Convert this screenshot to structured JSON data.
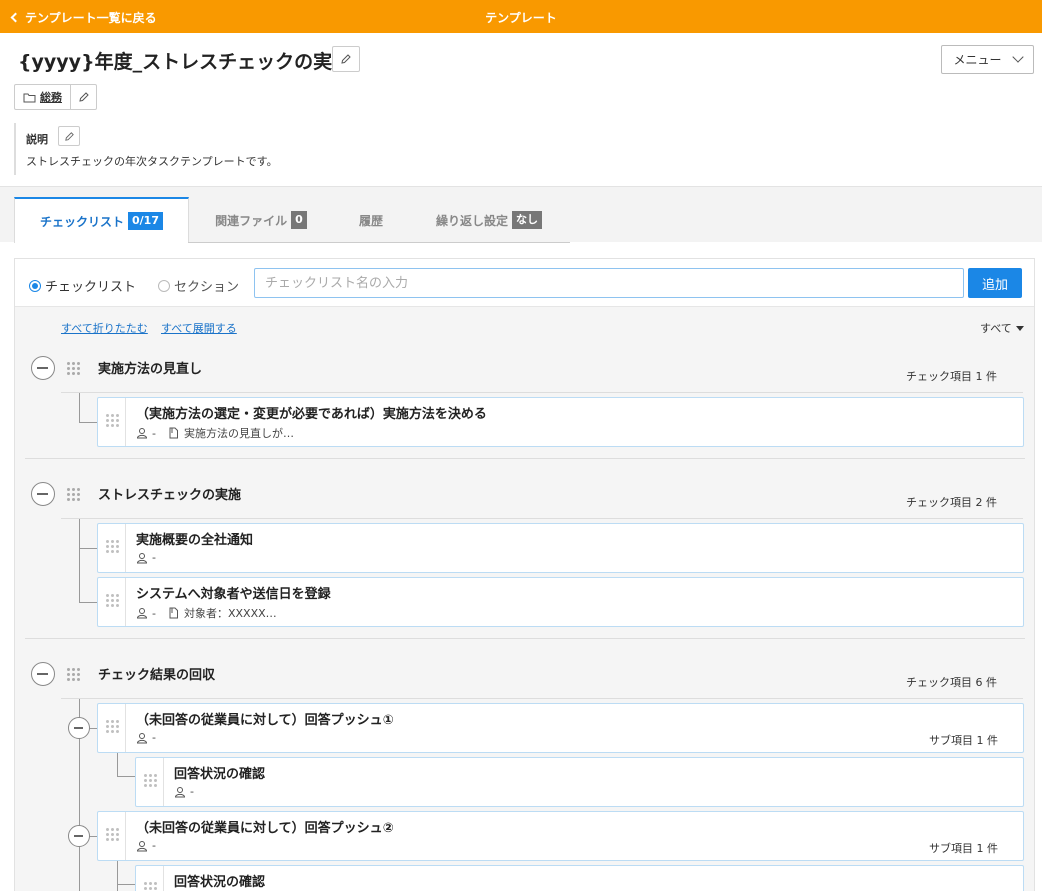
{
  "topbar": {
    "back_label": "テンプレート一覧に戻る",
    "title": "テンプレート"
  },
  "header": {
    "page_title": "{yyyy}年度_ストレスチェックの実施",
    "menu_label": "メニュー",
    "category": "総務"
  },
  "description": {
    "label": "説明",
    "text": "ストレスチェックの年次タスクテンプレートです。"
  },
  "tabs": [
    {
      "label": "チェックリスト",
      "badge": "0/17"
    },
    {
      "label": "関連ファイル",
      "badge": "0"
    },
    {
      "label": "履歴",
      "badge": ""
    },
    {
      "label": "繰り返し設定",
      "badge": "なし"
    }
  ],
  "add_row": {
    "radio_checklist": "チェックリスト",
    "radio_section": "セクション",
    "input_placeholder": "チェックリスト名の入力",
    "input_value": "",
    "add_label": "追加"
  },
  "controls": {
    "collapse_all": "すべて折りたたむ",
    "expand_all": "すべて展開する",
    "filter": "すべて"
  },
  "sections": [
    {
      "title": "実施方法の見直し",
      "count": "チェック項目 1 件",
      "items": [
        {
          "title": "（実施方法の選定・変更が必要であれば）実施方法を決める",
          "assignee": "-",
          "note": "実施方法の見直しが…"
        }
      ]
    },
    {
      "title": "ストレスチェックの実施",
      "count": "チェック項目 2 件",
      "items": [
        {
          "title": "実施概要の全社通知",
          "assignee": "-",
          "note": ""
        },
        {
          "title": "システムへ対象者や送信日を登録",
          "assignee": "-",
          "note": "対象者：XXXXX…"
        }
      ]
    },
    {
      "title": "チェック結果の回収",
      "count": "チェック項目 6 件",
      "items": [
        {
          "title": "（未回答の従業員に対して）回答プッシュ①",
          "assignee": "-",
          "sub_count": "サブ項目 1 件",
          "children": [
            {
              "title": "回答状況の確認",
              "assignee": "-"
            }
          ]
        },
        {
          "title": "（未回答の従業員に対して）回答プッシュ②",
          "assignee": "-",
          "sub_count": "サブ項目 1 件",
          "children": [
            {
              "title": "回答状況の確認",
              "assignee": ""
            }
          ]
        }
      ]
    }
  ],
  "colors": {
    "topbar": "#f99900",
    "accent": "#1b87e6"
  },
  "icons": {
    "back": "chevron-left-icon",
    "edit": "pencil-icon",
    "folder": "folder-icon",
    "user": "user-icon",
    "doc": "document-icon",
    "collapse": "minus-circle-icon",
    "drag": "drag-handle-icon"
  }
}
